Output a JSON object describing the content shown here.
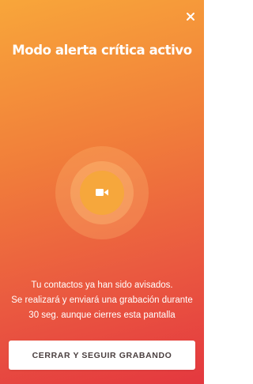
{
  "screen": {
    "title": "Modo alerta crítica activo",
    "close_icon": "close-icon",
    "record_icon": "video-camera-icon",
    "message_lines": [
      "Tu contactos ya han sido avisados.",
      "Se realizará y enviará una grabación durante",
      "30 seg. aunque cierres esta pantalla"
    ],
    "action_button_label": "CERRAR Y SEGUIR GRABANDO"
  },
  "colors": {
    "gradient_top": "#f8a63a",
    "gradient_bottom": "#e4383f",
    "record_button": "#f6a73c",
    "button_text": "#4a3f3f"
  }
}
